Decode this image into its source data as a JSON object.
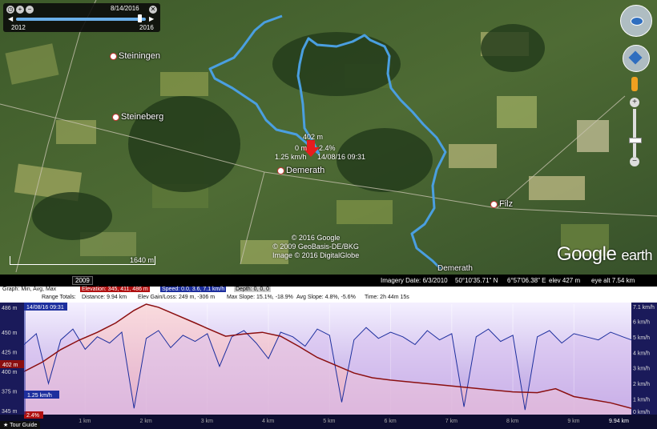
{
  "timeline": {
    "date": "8/14/2016",
    "start_year": "2012",
    "end_year": "2016",
    "history_year": "2009"
  },
  "map": {
    "towns": [
      {
        "name": "Steiningen",
        "x": 137,
        "y": 68
      },
      {
        "name": "Steineberg",
        "x": 140,
        "y": 140
      },
      {
        "name": "Demerath",
        "x": 348,
        "y": 208
      },
      {
        "name": "Filz",
        "x": 614,
        "y": 250
      },
      {
        "name": "Demerath",
        "x": 546,
        "y": 309
      }
    ],
    "scale_label": "1640 m",
    "track_popup": {
      "elevation": "402 m",
      "distance": "0 m",
      "slope": "2.4%",
      "speed": "1.25 km/h",
      "timestamp": "14/08/16 09:31"
    },
    "copyright": [
      "© 2016 Google",
      "© 2009 GeoBasis-DE/BKG",
      "Image © 2016 DigitalGlobe"
    ],
    "logo_google": "Google",
    "logo_earth": "earth",
    "track_color": "#4a9fe0",
    "marker_color": "#e81d1d"
  },
  "status_bar": {
    "imagery_date": "Imagery Date: 6/3/2010",
    "lat": "50°10'35.71\" N",
    "lon": "6°57'06.38\" E",
    "elev": "elev   427 m",
    "eye_alt": "eye alt   7.54 km"
  },
  "profile": {
    "graph_label": "Graph: Min, Avg, Max",
    "elevation_label": "Elevation: 345, 411, 486 m",
    "speed_label": "Speed: 0.0, 3.6, 7.1 km/h",
    "depth_label": "Depth: 0, 0, 0",
    "range_totals": "Range Totals:",
    "distance": "Distance: 9.94 km",
    "gain_loss": "Elev Gain/Loss: 249 m, -306 m",
    "max_slope": "Max Slope: 15.1%, -18.9%",
    "avg_slope": "Avg Slope: 4.8%, -5.6%",
    "time": "Time: 2h 44m 15s",
    "cursor_time": "14/08/16 09:31",
    "cursor_elev": "402 m",
    "cursor_speed": "1.25 km/h",
    "cursor_slope": "2.4%",
    "end_distance": "9.94 km",
    "tour_button": "Tour Guide"
  },
  "chart_data": {
    "type": "line",
    "xlabel": "",
    "x_ticks": [
      "1 km",
      "2 km",
      "3 km",
      "4 km",
      "5 km",
      "6 km",
      "7 km",
      "8 km",
      "9 km",
      "9.94 km"
    ],
    "y_left_ticks": [
      "486 m",
      "450 m",
      "425 m",
      "400 m",
      "375 m",
      "345 m"
    ],
    "y_right_ticks": [
      "7.1 km/h",
      "6 km/h",
      "5 km/h",
      "4 km/h",
      "3 km/h",
      "2 km/h",
      "1 km/h",
      "0 km/h"
    ],
    "xlim": [
      0,
      9.94
    ],
    "ylim_left": [
      345,
      486
    ],
    "ylim_right": [
      0,
      7.1
    ],
    "series": [
      {
        "name": "Elevation",
        "axis": "left",
        "color": "#8b0f10",
        "x": [
          0,
          0.3,
          0.6,
          0.9,
          1.2,
          1.5,
          1.8,
          2.0,
          2.2,
          2.5,
          2.8,
          3.0,
          3.3,
          3.6,
          3.9,
          4.2,
          4.5,
          4.8,
          5.1,
          5.4,
          5.7,
          6.0,
          6.4,
          6.8,
          7.2,
          7.6,
          8.0,
          8.4,
          8.7,
          9.0,
          9.3,
          9.6,
          9.94
        ],
        "values": [
          400,
          412,
          428,
          440,
          450,
          462,
          478,
          486,
          482,
          472,
          462,
          455,
          445,
          448,
          450,
          445,
          432,
          418,
          408,
          398,
          392,
          389,
          386,
          383,
          380,
          377,
          374,
          373,
          378,
          368,
          364,
          360,
          353
        ]
      },
      {
        "name": "Speed",
        "axis": "right",
        "color": "#1d2f9e",
        "x": [
          0,
          0.2,
          0.4,
          0.6,
          0.8,
          1.0,
          1.2,
          1.4,
          1.6,
          1.8,
          2.0,
          2.2,
          2.4,
          2.6,
          2.8,
          3.0,
          3.2,
          3.4,
          3.6,
          3.8,
          4.0,
          4.2,
          4.4,
          4.6,
          4.8,
          5.0,
          5.2,
          5.4,
          5.6,
          5.8,
          6.0,
          6.2,
          6.4,
          6.6,
          6.8,
          7.0,
          7.2,
          7.4,
          7.6,
          7.8,
          8.0,
          8.2,
          8.4,
          8.6,
          8.8,
          9.0,
          9.2,
          9.4,
          9.6,
          9.8,
          9.94
        ],
        "values": [
          4.5,
          5.2,
          2.0,
          4.8,
          5.5,
          4.2,
          5.0,
          4.6,
          5.3,
          0.4,
          4.9,
          5.4,
          4.3,
          5.1,
          4.7,
          5.2,
          3.1,
          5.0,
          5.4,
          4.6,
          3.6,
          5.3,
          5.0,
          4.4,
          5.5,
          5.1,
          0.8,
          4.8,
          5.6,
          4.9,
          5.3,
          5.0,
          4.5,
          5.4,
          4.8,
          5.2,
          0.5,
          5.0,
          5.5,
          4.7,
          5.1,
          0.3,
          5.0,
          5.4,
          4.6,
          5.2,
          5.0,
          4.8,
          5.3,
          5.0,
          4.8
        ]
      }
    ]
  }
}
